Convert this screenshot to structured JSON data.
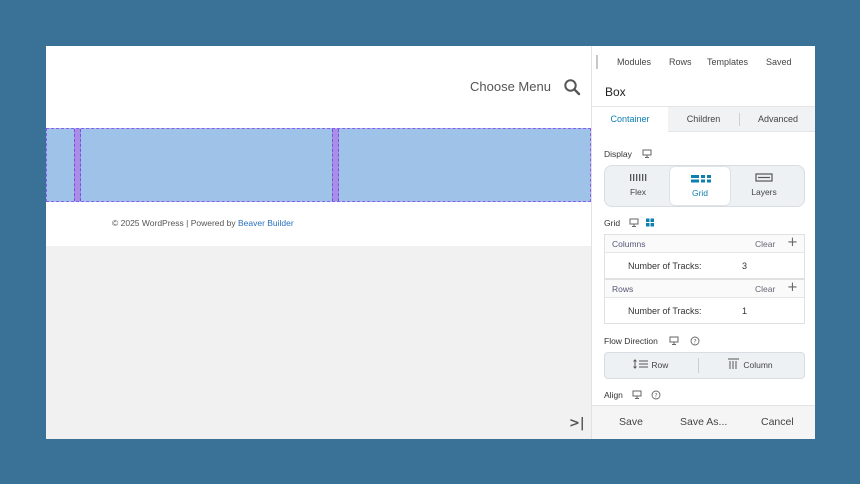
{
  "preview": {
    "nav_label": "Choose Menu",
    "search_icon": "search-icon",
    "footer_text": "© 2025 WordPress | Powered by ",
    "footer_link": "Beaver Builder",
    "collapse_glyph": ">|",
    "colors": {
      "grid_fill": "#9fc3e8",
      "grid_outline": "#8a5cf0",
      "link": "#2a6fbe"
    }
  },
  "panel": {
    "top_tabs": [
      "Modules",
      "Rows",
      "Templates",
      "Saved"
    ],
    "title": "Box",
    "settings_tabs": [
      "Container",
      "Children",
      "Advanced"
    ],
    "active_settings_tab": "Container",
    "display": {
      "label": "Display",
      "options": [
        {
          "label": "Flex",
          "icon": "flex-icon"
        },
        {
          "label": "Grid",
          "icon": "grid-icon"
        },
        {
          "label": "Layers",
          "icon": "layers-icon"
        }
      ],
      "selected": "Grid"
    },
    "grid": {
      "label": "Grid",
      "columns": {
        "label": "Columns",
        "clear": "Clear",
        "add": "+",
        "tracks_label": "Number of Tracks:",
        "tracks_value": "3"
      },
      "rows": {
        "label": "Rows",
        "clear": "Clear",
        "add": "+",
        "tracks_label": "Number of Tracks:",
        "tracks_value": "1"
      }
    },
    "flow_direction": {
      "label": "Flow Direction",
      "options": [
        {
          "label": "Row",
          "icon": "row-icon"
        },
        {
          "label": "Column",
          "icon": "column-icon"
        }
      ]
    },
    "align": {
      "label": "Align"
    },
    "footer": {
      "save": "Save",
      "save_as": "Save As...",
      "cancel": "Cancel"
    },
    "colors": {
      "accent": "#0e7fb0"
    }
  }
}
